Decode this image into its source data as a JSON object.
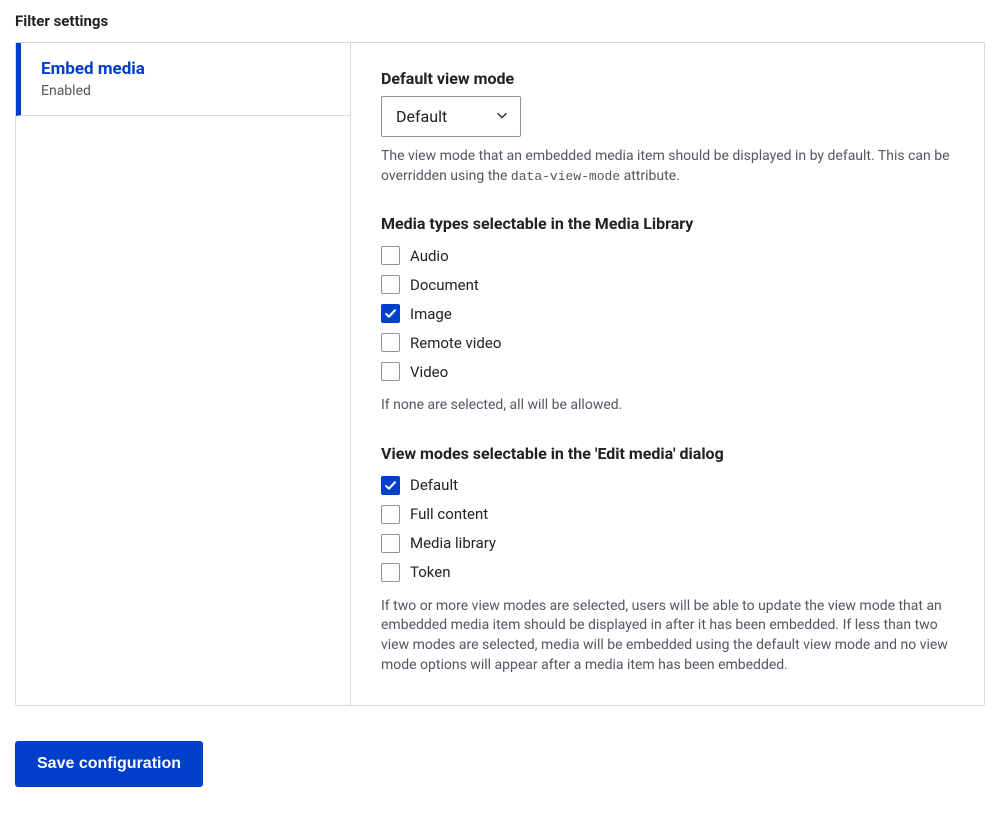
{
  "header": "Filter settings",
  "tab": {
    "title": "Embed media",
    "status": "Enabled"
  },
  "defaultViewMode": {
    "label": "Default view mode",
    "selected": "Default",
    "description_prefix": "The view mode that an embedded media item should be displayed in by default. This can be overridden using the ",
    "description_code": "data-view-mode",
    "description_suffix": " attribute."
  },
  "mediaTypes": {
    "label": "Media types selectable in the Media Library",
    "options": [
      {
        "label": "Audio",
        "checked": false
      },
      {
        "label": "Document",
        "checked": false
      },
      {
        "label": "Image",
        "checked": true
      },
      {
        "label": "Remote video",
        "checked": false
      },
      {
        "label": "Video",
        "checked": false
      }
    ],
    "help": "If none are selected, all will be allowed."
  },
  "viewModes": {
    "label": "View modes selectable in the 'Edit media' dialog",
    "options": [
      {
        "label": "Default",
        "checked": true
      },
      {
        "label": "Full content",
        "checked": false
      },
      {
        "label": "Media library",
        "checked": false
      },
      {
        "label": "Token",
        "checked": false
      }
    ],
    "help": "If two or more view modes are selected, users will be able to update the view mode that an embedded media item should be displayed in after it has been embedded. If less than two view modes are selected, media will be embedded using the default view mode and no view mode options will appear after a media item has been embedded."
  },
  "saveButton": "Save configuration"
}
